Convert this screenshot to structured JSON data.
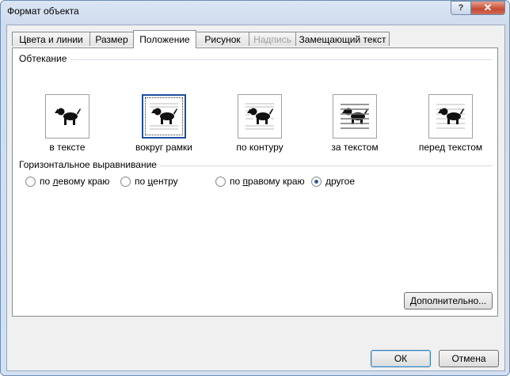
{
  "window": {
    "title": "Формат объекта",
    "help_label": "?",
    "close_label": "✕"
  },
  "tabs": [
    {
      "label": "Цвета и линии",
      "state": "normal"
    },
    {
      "label": "Размер",
      "state": "normal"
    },
    {
      "label": "Положение",
      "state": "active"
    },
    {
      "label": "Рисунок",
      "state": "normal"
    },
    {
      "label": "Надпись",
      "state": "disabled"
    },
    {
      "label": "Замещающий текст",
      "state": "normal"
    }
  ],
  "wrapping": {
    "group_label": "Обтекание",
    "options": [
      {
        "label": "в тексте",
        "icon": "inline-with-text-icon",
        "selected": false
      },
      {
        "label": "вокруг рамки",
        "icon": "square-wrap-icon",
        "selected": true
      },
      {
        "label": "по контуру",
        "icon": "tight-wrap-icon",
        "selected": false
      },
      {
        "label": "за текстом",
        "icon": "behind-text-icon",
        "selected": false
      },
      {
        "label": "перед текстом",
        "icon": "in-front-of-text-icon",
        "selected": false
      }
    ]
  },
  "horizontal_alignment": {
    "group_label": "Горизонтальное выравнивание",
    "options": [
      {
        "label": "по левому краю",
        "accel": "л",
        "checked": false
      },
      {
        "label": "по центру",
        "accel": "ц",
        "checked": false
      },
      {
        "label": "по правому краю",
        "accel": "п",
        "checked": false
      },
      {
        "label": "другое",
        "accel": "д",
        "checked": true
      }
    ]
  },
  "buttons": {
    "advanced": "Дополнительно...",
    "ok": "ОК",
    "cancel": "Отмена"
  },
  "colors": {
    "selected_border": "#1c4f9f",
    "radio_dot": "#2f5c9d"
  }
}
